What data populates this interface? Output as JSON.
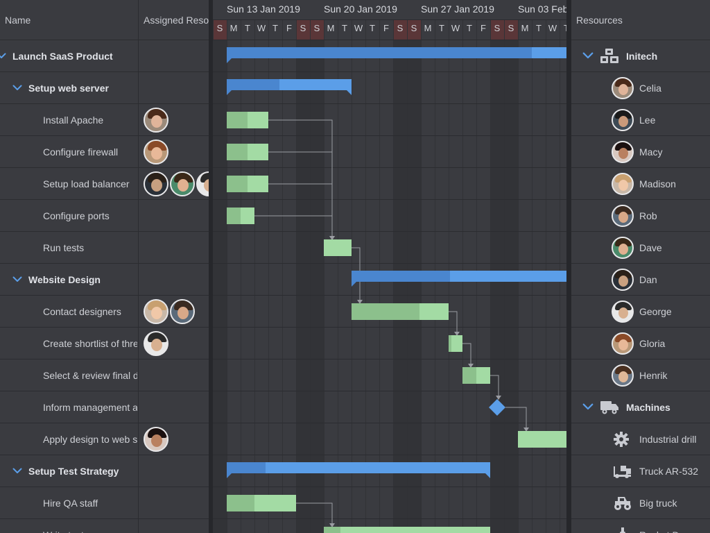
{
  "colors": {
    "background": "#3a3b40",
    "weekend": "#323337",
    "weekend_header": "#5a3638",
    "summary_bar": "#5b9ee8",
    "summary_progress": "#4a86cf",
    "task_bar": "#a3dba4",
    "task_progress": "#8cc08c",
    "milestone": "#5b9ee8",
    "dependency_line": "#9a9ca2",
    "accent": "#5b9ee8"
  },
  "grid": {
    "col_name": "Name",
    "col_resources": "Assigned Resources"
  },
  "timeline": {
    "weeks": [
      "Sun 13 Jan 2019",
      "Sun 20 Jan 2019",
      "Sun 27 Jan 2019",
      "Sun 03 Feb"
    ],
    "days": [
      "S",
      "M",
      "T",
      "W",
      "T",
      "F",
      "S",
      "S",
      "M",
      "T",
      "W",
      "T",
      "F",
      "S",
      "S",
      "M",
      "T",
      "W",
      "T",
      "F",
      "S",
      "S",
      "M",
      "T",
      "W",
      "T"
    ]
  },
  "tasks": [
    {
      "name": "Launch SaaS Product",
      "summary": true,
      "level": 0,
      "avatars": [],
      "start": 1,
      "end": 26,
      "progress": 22
    },
    {
      "name": "Setup web server",
      "summary": true,
      "level": 1,
      "avatars": [],
      "start": 1,
      "end": 10,
      "progress": 3.8
    },
    {
      "name": "Install Apache",
      "level": 2,
      "avatars": [
        "celia"
      ],
      "start": 1,
      "end": 4,
      "progress": 1.5
    },
    {
      "name": "Configure firewall",
      "level": 2,
      "avatars": [
        "gloria"
      ],
      "start": 1,
      "end": 4,
      "progress": 1.5
    },
    {
      "name": "Setup load balancer",
      "level": 2,
      "avatars": [
        "dan",
        "dave",
        "george"
      ],
      "start": 1,
      "end": 4,
      "progress": 1.5
    },
    {
      "name": "Configure ports",
      "level": 2,
      "avatars": [],
      "start": 1,
      "end": 3,
      "progress": 1
    },
    {
      "name": "Run tests",
      "level": 2,
      "avatars": [],
      "start": 8,
      "end": 10,
      "progress": 0
    },
    {
      "name": "Website Design",
      "summary": true,
      "level": 1,
      "avatars": [],
      "start": 10,
      "end": 26,
      "progress": 7.1
    },
    {
      "name": "Contact designers",
      "level": 2,
      "avatars": [
        "madison",
        "rob"
      ],
      "start": 10,
      "end": 17,
      "progress": 4.9
    },
    {
      "name": "Create shortlist of three designers",
      "level": 2,
      "avatars": [
        "george"
      ],
      "start": 17,
      "end": 18,
      "progress": 0.2
    },
    {
      "name": "Select & review final design",
      "level": 2,
      "avatars": [],
      "start": 18,
      "end": 20,
      "progress": 1
    },
    {
      "name": "Inform management about decision",
      "level": 2,
      "avatars": [],
      "milestone": true,
      "start": 20,
      "end": 20,
      "progress": 0
    },
    {
      "name": "Apply design to web site",
      "level": 2,
      "avatars": [
        "macy"
      ],
      "start": 22,
      "end": 26,
      "progress": 0
    },
    {
      "name": "Setup Test Strategy",
      "summary": true,
      "level": 1,
      "avatars": [],
      "start": 1,
      "end": 20,
      "progress": 2.8
    },
    {
      "name": "Hire QA staff",
      "level": 2,
      "avatars": [],
      "start": 1,
      "end": 6,
      "progress": 2
    },
    {
      "name": "Write test specs",
      "level": 2,
      "avatars": [],
      "start": 8,
      "end": 20,
      "progress": 1.2,
      "partial": true
    }
  ],
  "dependencies": [
    [
      2,
      6
    ],
    [
      3,
      6
    ],
    [
      4,
      6
    ],
    [
      5,
      6
    ],
    [
      6,
      8
    ],
    [
      8,
      9
    ],
    [
      9,
      10
    ],
    [
      10,
      11
    ],
    [
      11,
      12
    ],
    [
      14,
      15
    ]
  ],
  "resources": {
    "header": "Resources",
    "items": [
      {
        "name": "Initech",
        "group": true,
        "icon": "cubes-icon"
      },
      {
        "name": "Celia",
        "avatar": "celia"
      },
      {
        "name": "Lee",
        "avatar": "lee"
      },
      {
        "name": "Macy",
        "avatar": "macy"
      },
      {
        "name": "Madison",
        "avatar": "madison"
      },
      {
        "name": "Rob",
        "avatar": "rob"
      },
      {
        "name": "Dave",
        "avatar": "dave"
      },
      {
        "name": "Dan",
        "avatar": "dan"
      },
      {
        "name": "George",
        "avatar": "george"
      },
      {
        "name": "Gloria",
        "avatar": "gloria"
      },
      {
        "name": "Henrik",
        "avatar": "henrik"
      },
      {
        "name": "Machines",
        "group": true,
        "icon": "truck-icon"
      },
      {
        "name": "Industrial drill",
        "icon": "gear-icon"
      },
      {
        "name": "Truck AR-532",
        "icon": "truck-loading-icon"
      },
      {
        "name": "Big truck",
        "icon": "monster-truck-icon"
      },
      {
        "name": "Rocket Drone",
        "icon": "drone-icon",
        "partial": true
      }
    ]
  },
  "people": {
    "celia": {
      "skin": "#e0b49a",
      "hair": "#4a2a1a",
      "bg": "#9b8a7a"
    },
    "lee": {
      "skin": "#c99a7a",
      "hair": "#1a1a1a",
      "bg": "#3d4a55"
    },
    "macy": {
      "skin": "#b98060",
      "hair": "#1a1010",
      "bg": "#d8c8c0"
    },
    "madison": {
      "skin": "#f0c8a8",
      "hair": "#c8a070",
      "bg": "#c8b8a8"
    },
    "rob": {
      "skin": "#d8a888",
      "hair": "#3a2a20",
      "bg": "#5a6a7a"
    },
    "dave": {
      "skin": "#e0b090",
      "hair": "#3a2818",
      "bg": "#4a8a6a"
    },
    "dan": {
      "skin": "#c8a080",
      "hair": "#2a2018",
      "bg": "#2a3038"
    },
    "george": {
      "skin": "#d8b090",
      "hair": "#2a2a2a",
      "bg": "#e8e8e8"
    },
    "gloria": {
      "skin": "#e8b898",
      "hair": "#8a4a28",
      "bg": "#b89878"
    },
    "henrik": {
      "skin": "#e0b898",
      "hair": "#4a3020",
      "bg": "#6a7888"
    }
  }
}
